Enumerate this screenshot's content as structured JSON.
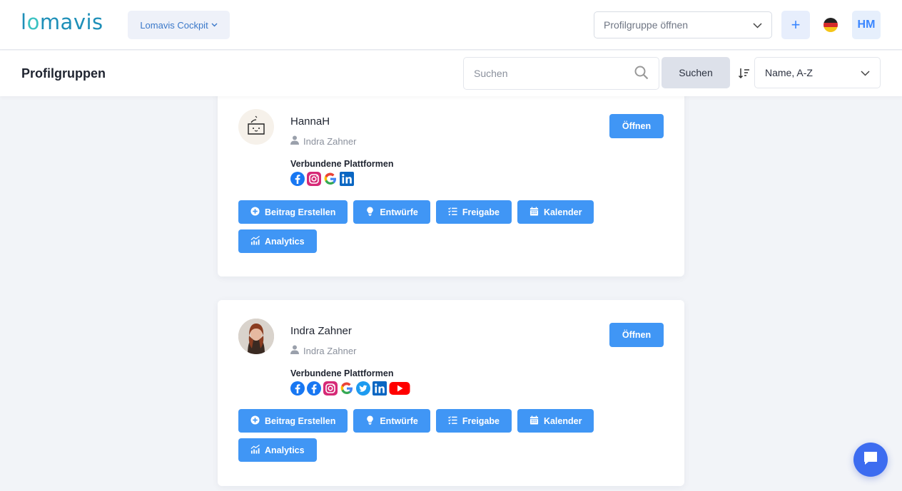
{
  "topbar": {
    "logo": {
      "pre": "l",
      "o": "o",
      "post": "mavis"
    },
    "workspace_label": "Lomavis Cockpit",
    "profile_group_placeholder": "Profilgruppe öffnen",
    "add_label": "+",
    "language_flag": "german-flag-icon",
    "user_initials": "HM"
  },
  "subbar": {
    "title": "Profilgruppen",
    "search_placeholder": "Suchen",
    "search_button": "Suchen",
    "sort_value": "Name, A-Z"
  },
  "colors": {
    "accent": "#4096f5",
    "brand": "#1e8fb8",
    "chat": "#3d6cf0"
  },
  "cards": [
    {
      "name": "HannaH",
      "owner": "Indra Zahner",
      "platforms_label": "Verbundene Plattformen",
      "platforms": [
        "facebook",
        "instagram",
        "google",
        "linkedin"
      ],
      "open_label": "Öffnen",
      "actions": [
        {
          "label": "Beitrag Erstellen",
          "icon": "plus-circle-icon"
        },
        {
          "label": "Entwürfe",
          "icon": "lightbulb-icon"
        },
        {
          "label": "Freigabe",
          "icon": "checklist-icon"
        },
        {
          "label": "Kalender",
          "icon": "calendar-icon"
        },
        {
          "label": "Analytics",
          "icon": "analytics-icon"
        }
      ]
    },
    {
      "name": "Indra Zahner",
      "owner": "Indra Zahner",
      "platforms_label": "Verbundene Plattformen",
      "platforms": [
        "facebook",
        "facebook",
        "instagram",
        "google",
        "twitter",
        "linkedin",
        "youtube"
      ],
      "open_label": "Öffnen",
      "actions": [
        {
          "label": "Beitrag Erstellen",
          "icon": "plus-circle-icon"
        },
        {
          "label": "Entwürfe",
          "icon": "lightbulb-icon"
        },
        {
          "label": "Freigabe",
          "icon": "checklist-icon"
        },
        {
          "label": "Kalender",
          "icon": "calendar-icon"
        },
        {
          "label": "Analytics",
          "icon": "analytics-icon"
        }
      ]
    }
  ]
}
